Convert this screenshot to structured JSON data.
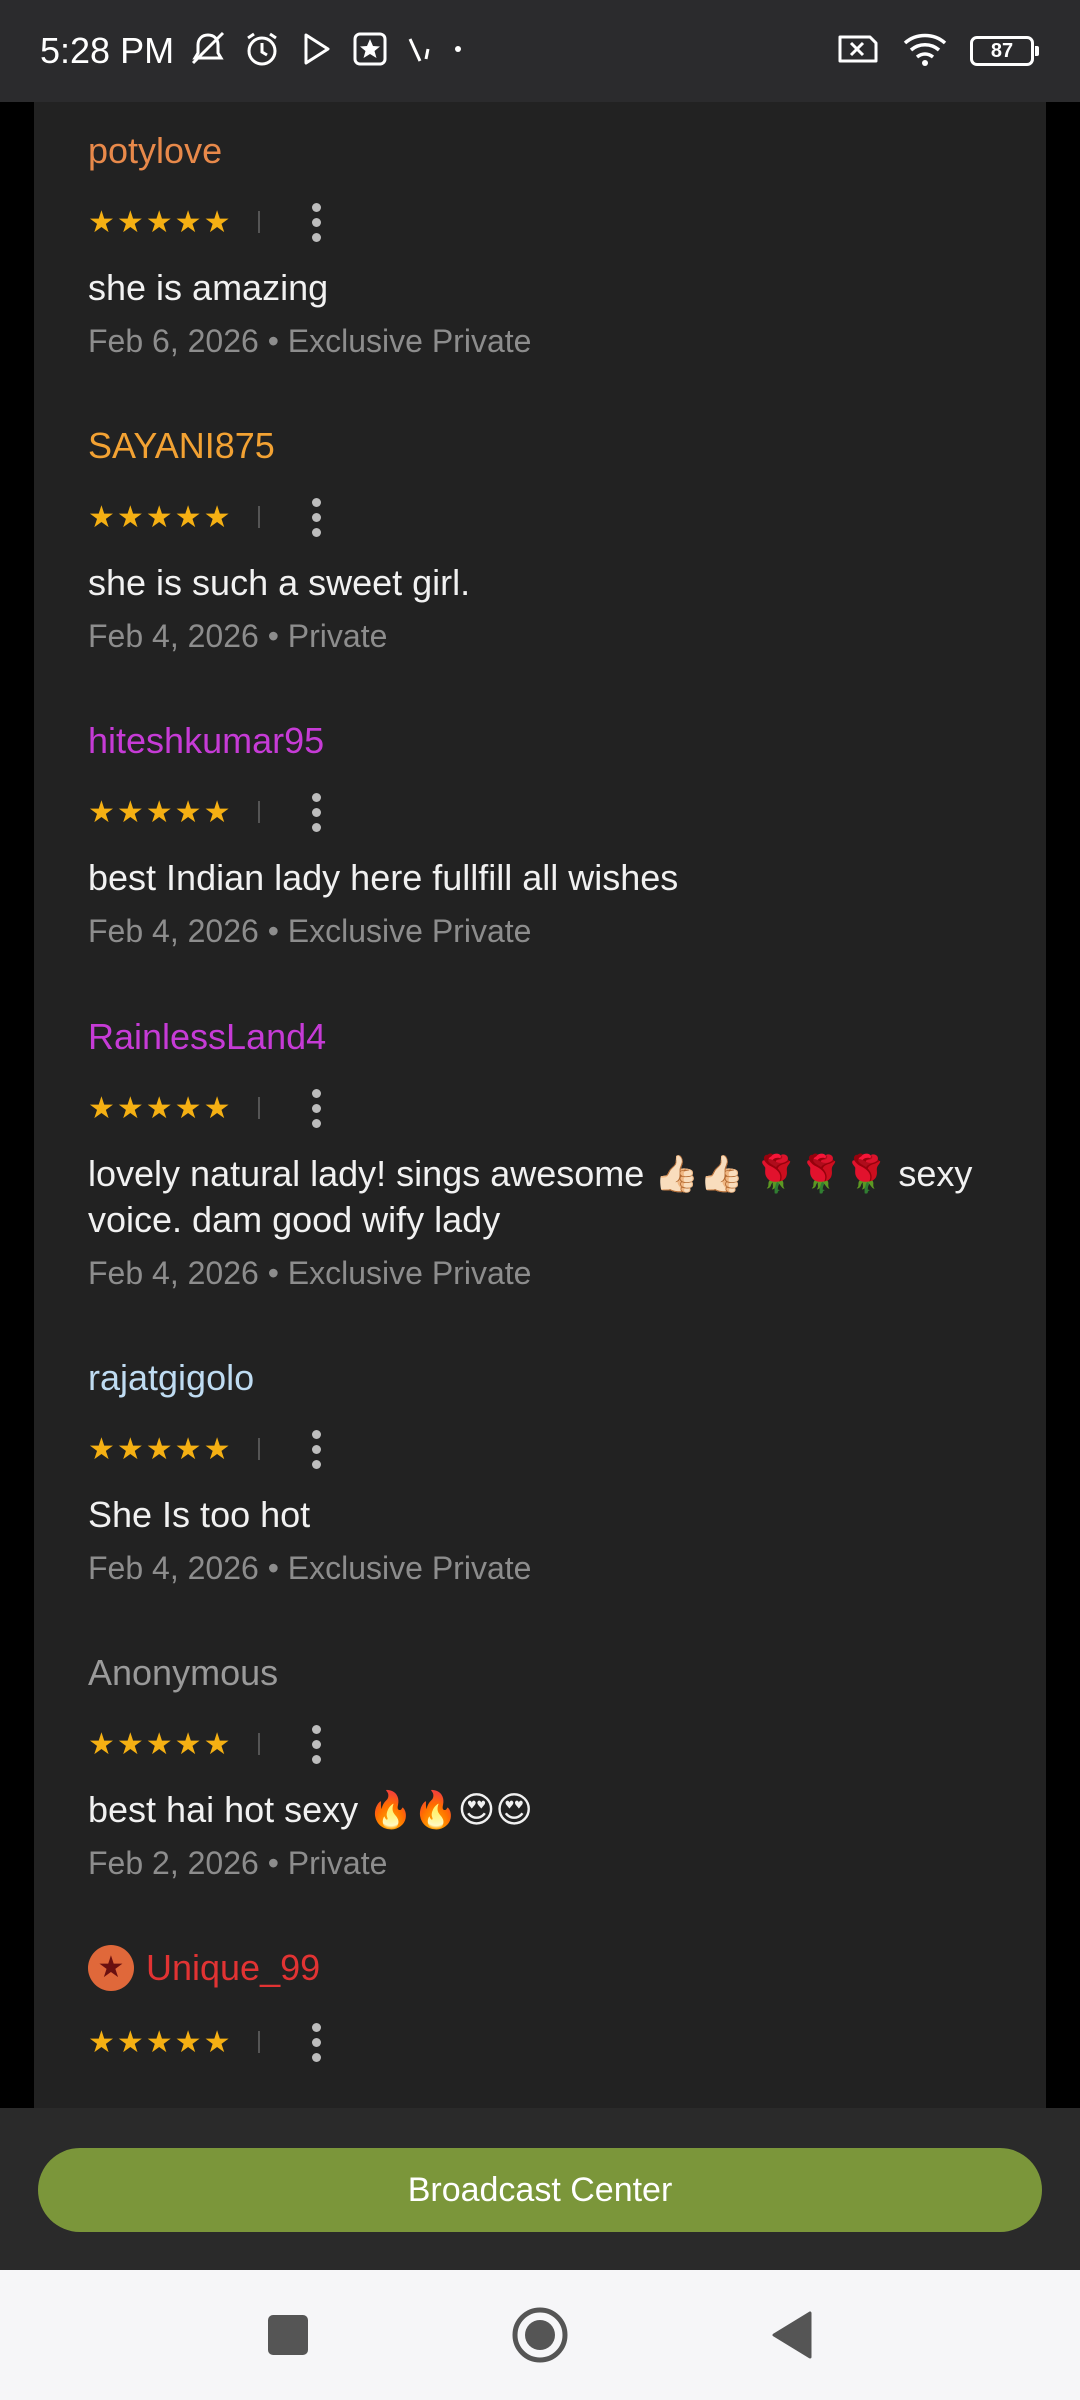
{
  "status_bar": {
    "time": "5:28 PM",
    "battery": "87",
    "left_icons": [
      "bell-off-icon",
      "alarm-icon",
      "play-store-icon",
      "star-badge-icon",
      "signal-slash-icon",
      "dot-icon"
    ],
    "right_icons": [
      "no-sim-icon",
      "wifi-icon",
      "battery-icon"
    ]
  },
  "reviews": [
    {
      "username": "potylove",
      "color": "#e8894a",
      "stars": "★★★★★",
      "comment": "she is amazing",
      "meta": "Feb 6, 2026 • Exclusive Private"
    },
    {
      "username": "SAYANI875",
      "color": "#f3a233",
      "stars": "★★★★★",
      "comment": "she is such a sweet girl.",
      "meta": "Feb 4, 2026 • Private"
    },
    {
      "username": "hiteshkumar95",
      "color": "#c63bd6",
      "stars": "★★★★★",
      "comment": "best Indian lady here fullfill all wishes",
      "meta": "Feb 4, 2026 • Exclusive Private"
    },
    {
      "username": "RainlessLand4",
      "color": "#c63bd6",
      "stars": "★★★★★",
      "comment": "lovely natural lady! sings awesome 👍🏻👍🏻 🌹🌹🌹 sexy voice. dam good wify lady",
      "meta": "Feb 4, 2026 • Exclusive Private"
    },
    {
      "username": "rajatgigolo",
      "color": "#bfdcf2",
      "stars": "★★★★★",
      "comment": "She Is too hot",
      "meta": "Feb 4, 2026 • Exclusive Private"
    },
    {
      "username": "Anonymous",
      "color": "#9a9a9a",
      "stars": "★★★★★",
      "comment": "best hai hot sexy 🔥🔥😍😍",
      "meta": "Feb 2, 2026 • Private"
    },
    {
      "username": "Unique_99",
      "color": "#e23333",
      "stars": "★★★★★",
      "badge": "★"
    }
  ],
  "bottom": {
    "broadcast_label": "Broadcast Center",
    "broadcast_color": "#7b963a"
  },
  "nav": {
    "icons": [
      "recents-square-icon",
      "home-circle-icon",
      "back-triangle-icon"
    ]
  }
}
